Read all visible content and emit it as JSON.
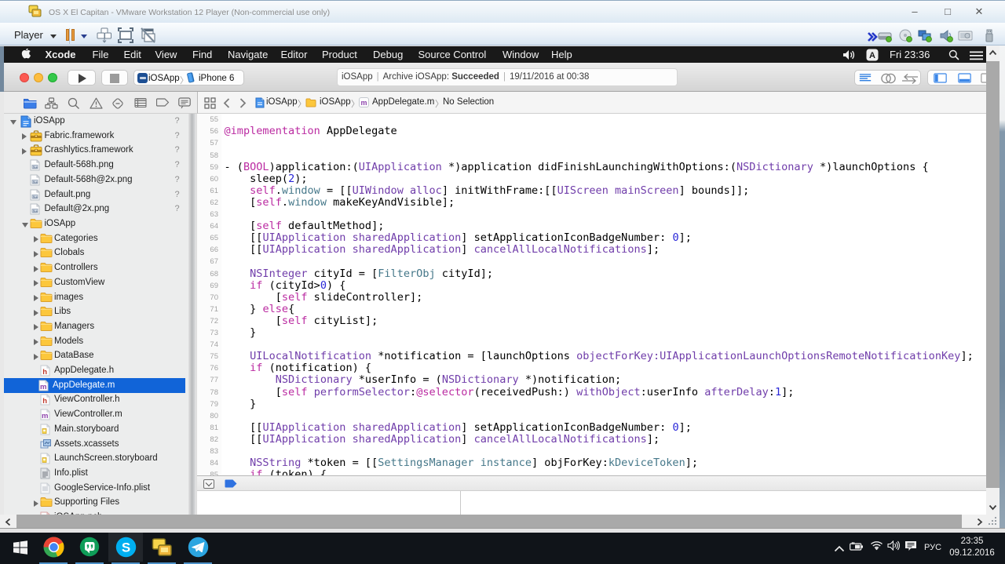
{
  "vmware": {
    "title": "OS X El Capitan - VMware Workstation 12 Player (Non-commercial use only)",
    "window_buttons": [
      "minimize",
      "maximize",
      "close"
    ],
    "toolbar": {
      "player_label": "Player",
      "tray_icons": [
        "chevrons",
        "harddisk",
        "cdrom",
        "network",
        "sound",
        "display",
        "usb"
      ]
    }
  },
  "macos": {
    "menubar": {
      "items": [
        "Xcode",
        "File",
        "Edit",
        "View",
        "Find",
        "Navigate",
        "Editor",
        "Product",
        "Debug",
        "Source Control",
        "Window",
        "Help"
      ],
      "clock": "Fri 23:36"
    }
  },
  "xcode": {
    "toolbar": {
      "scheme": {
        "project": "iOSApp",
        "device": "iPhone 6"
      },
      "status": {
        "project": "iOSApp",
        "action": "Archive iOSApp:",
        "result": "Succeeded",
        "date": "19/11/2016 at 00:38"
      }
    },
    "jumpbar": {
      "segments": [
        "iOSApp",
        "iOSApp",
        "AppDelegate.m",
        "No Selection"
      ]
    },
    "navigator": {
      "rows": [
        {
          "depth": 0,
          "disc": "down",
          "icon": "project",
          "label": "iOSApp",
          "badge": "?"
        },
        {
          "depth": 1,
          "disc": "right",
          "icon": "framework",
          "label": "Fabric.framework",
          "badge": "?"
        },
        {
          "depth": 1,
          "disc": "right",
          "icon": "framework",
          "label": "Crashlytics.framework",
          "badge": "?"
        },
        {
          "depth": 1,
          "disc": "",
          "icon": "imagefile",
          "label": "Default-568h.png",
          "badge": "?"
        },
        {
          "depth": 1,
          "disc": "",
          "icon": "imagefile",
          "label": "Default-568h@2x.png",
          "badge": "?"
        },
        {
          "depth": 1,
          "disc": "",
          "icon": "imagefile",
          "label": "Default.png",
          "badge": "?"
        },
        {
          "depth": 1,
          "disc": "",
          "icon": "imagefile",
          "label": "Default@2x.png",
          "badge": "?"
        },
        {
          "depth": 1,
          "disc": "down",
          "icon": "folder",
          "label": "iOSApp",
          "badge": ""
        },
        {
          "depth": 2,
          "disc": "right",
          "icon": "folder",
          "label": "Categories",
          "badge": ""
        },
        {
          "depth": 2,
          "disc": "right",
          "icon": "folder",
          "label": "Clobals",
          "badge": ""
        },
        {
          "depth": 2,
          "disc": "right",
          "icon": "folder",
          "label": "Controllers",
          "badge": ""
        },
        {
          "depth": 2,
          "disc": "right",
          "icon": "folder",
          "label": "CustomView",
          "badge": ""
        },
        {
          "depth": 2,
          "disc": "right",
          "icon": "folder",
          "label": "images",
          "badge": ""
        },
        {
          "depth": 2,
          "disc": "right",
          "icon": "folder",
          "label": "Libs",
          "badge": ""
        },
        {
          "depth": 2,
          "disc": "right",
          "icon": "folder",
          "label": "Managers",
          "badge": ""
        },
        {
          "depth": 2,
          "disc": "right",
          "icon": "folder",
          "label": "Models",
          "badge": ""
        },
        {
          "depth": 2,
          "disc": "right",
          "icon": "folder",
          "label": "DataBase",
          "badge": ""
        },
        {
          "depth": 2,
          "disc": "",
          "icon": "hfile",
          "label": "AppDelegate.h",
          "badge": ""
        },
        {
          "depth": 2,
          "disc": "",
          "icon": "mfile",
          "label": "AppDelegate.m",
          "badge": "",
          "selected": true
        },
        {
          "depth": 2,
          "disc": "",
          "icon": "hfile",
          "label": "ViewController.h",
          "badge": ""
        },
        {
          "depth": 2,
          "disc": "",
          "icon": "mfile",
          "label": "ViewController.m",
          "badge": ""
        },
        {
          "depth": 2,
          "disc": "",
          "icon": "storyboard",
          "label": "Main.storyboard",
          "badge": ""
        },
        {
          "depth": 2,
          "disc": "",
          "icon": "xcassets",
          "label": "Assets.xcassets",
          "badge": ""
        },
        {
          "depth": 2,
          "disc": "",
          "icon": "storyboard",
          "label": "LaunchScreen.storyboard",
          "badge": ""
        },
        {
          "depth": 2,
          "disc": "",
          "icon": "plist",
          "label": "Info.plist",
          "badge": ""
        },
        {
          "depth": 2,
          "disc": "",
          "icon": "plistlight",
          "label": "GoogleService-Info.plist",
          "badge": ""
        },
        {
          "depth": 2,
          "disc": "right",
          "icon": "folder",
          "label": "Supporting Files",
          "badge": ""
        },
        {
          "depth": 2,
          "disc": "",
          "icon": "pchfile",
          "label": "iOSApp.pch",
          "badge": ""
        }
      ]
    },
    "editor": {
      "lines": [
        {
          "n": 55,
          "t": []
        },
        {
          "n": 56,
          "t": [
            [
              "p",
              "@implementation"
            ],
            [
              "k",
              " AppDelegate"
            ]
          ]
        },
        {
          "n": 57,
          "t": []
        },
        {
          "n": 58,
          "t": []
        },
        {
          "n": 59,
          "t": [
            [
              "k",
              "- ("
            ],
            [
              "p",
              "BOOL"
            ],
            [
              "k",
              ")application:("
            ],
            [
              "v",
              "UIApplication"
            ],
            [
              "k",
              " *)application didFinishLaunchingWithOptions:("
            ],
            [
              "v",
              "NSDictionary"
            ],
            [
              "k",
              " *)launchOptions {"
            ]
          ]
        },
        {
          "n": 60,
          "t": [
            [
              "k",
              "    sleep("
            ],
            [
              "b",
              "2"
            ],
            [
              "k",
              ");"
            ]
          ]
        },
        {
          "n": 61,
          "t": [
            [
              "k",
              "    "
            ],
            [
              "p",
              "self"
            ],
            [
              "k",
              "."
            ],
            [
              "t",
              "window"
            ],
            [
              "k",
              " = [["
            ],
            [
              "v",
              "UIWindow"
            ],
            [
              "k",
              " "
            ],
            [
              "v",
              "alloc"
            ],
            [
              "k",
              "] initWithFrame:[["
            ],
            [
              "v",
              "UIScreen"
            ],
            [
              "k",
              " "
            ],
            [
              "v",
              "mainScreen"
            ],
            [
              "k",
              "] bounds]];"
            ]
          ]
        },
        {
          "n": 62,
          "t": [
            [
              "k",
              "    ["
            ],
            [
              "p",
              "self"
            ],
            [
              "k",
              "."
            ],
            [
              "t",
              "window"
            ],
            [
              "k",
              " makeKeyAndVisible];"
            ]
          ]
        },
        {
          "n": 63,
          "t": []
        },
        {
          "n": 64,
          "t": [
            [
              "k",
              "    ["
            ],
            [
              "p",
              "self"
            ],
            [
              "k",
              " defaultMethod];"
            ]
          ]
        },
        {
          "n": 65,
          "t": [
            [
              "k",
              "    [["
            ],
            [
              "v",
              "UIApplication"
            ],
            [
              "k",
              " "
            ],
            [
              "v",
              "sharedApplication"
            ],
            [
              "k",
              "] setApplicationIconBadgeNumber: "
            ],
            [
              "b",
              "0"
            ],
            [
              "k",
              "];"
            ]
          ]
        },
        {
          "n": 66,
          "t": [
            [
              "k",
              "    [["
            ],
            [
              "v",
              "UIApplication"
            ],
            [
              "k",
              " "
            ],
            [
              "v",
              "sharedApplication"
            ],
            [
              "k",
              "] "
            ],
            [
              "v",
              "cancelAllLocalNotifications"
            ],
            [
              "k",
              "];"
            ]
          ]
        },
        {
          "n": 67,
          "t": []
        },
        {
          "n": 68,
          "t": [
            [
              "k",
              "    "
            ],
            [
              "v",
              "NSInteger"
            ],
            [
              "k",
              " cityId = ["
            ],
            [
              "t",
              "FilterObj"
            ],
            [
              "k",
              " cityId];"
            ]
          ]
        },
        {
          "n": 69,
          "t": [
            [
              "k",
              "    "
            ],
            [
              "p",
              "if"
            ],
            [
              "k",
              " (cityId>"
            ],
            [
              "b",
              "0"
            ],
            [
              "k",
              ") {"
            ]
          ]
        },
        {
          "n": 70,
          "t": [
            [
              "k",
              "        ["
            ],
            [
              "p",
              "self"
            ],
            [
              "k",
              " slideController];"
            ]
          ]
        },
        {
          "n": 71,
          "t": [
            [
              "k",
              "    } "
            ],
            [
              "p",
              "else"
            ],
            [
              "k",
              "{"
            ]
          ]
        },
        {
          "n": 72,
          "t": [
            [
              "k",
              "        ["
            ],
            [
              "p",
              "self"
            ],
            [
              "k",
              " cityList];"
            ]
          ]
        },
        {
          "n": 73,
          "t": [
            [
              "k",
              "    }"
            ]
          ]
        },
        {
          "n": 74,
          "t": []
        },
        {
          "n": 75,
          "t": [
            [
              "k",
              "    "
            ],
            [
              "v",
              "UILocalNotification"
            ],
            [
              "k",
              " *notification = [launchOptions "
            ],
            [
              "v",
              "objectForKey:UIApplicationLaunchOptionsRemoteNotificationKey"
            ],
            [
              "k",
              "];"
            ]
          ]
        },
        {
          "n": 76,
          "t": [
            [
              "k",
              "    "
            ],
            [
              "p",
              "if"
            ],
            [
              "k",
              " (notification) {"
            ]
          ]
        },
        {
          "n": 77,
          "t": [
            [
              "k",
              "        "
            ],
            [
              "v",
              "NSDictionary"
            ],
            [
              "k",
              " *userInfo = ("
            ],
            [
              "v",
              "NSDictionary"
            ],
            [
              "k",
              " *)notification;"
            ]
          ]
        },
        {
          "n": 78,
          "t": [
            [
              "k",
              "        ["
            ],
            [
              "p",
              "self"
            ],
            [
              "k",
              " "
            ],
            [
              "v",
              "performSelector"
            ],
            [
              "k",
              ":"
            ],
            [
              "p",
              "@selector"
            ],
            [
              "k",
              "(receivedPush:) "
            ],
            [
              "v",
              "withObject"
            ],
            [
              "k",
              ":userInfo "
            ],
            [
              "v",
              "afterDelay"
            ],
            [
              "k",
              ":"
            ],
            [
              "b",
              "1"
            ],
            [
              "k",
              "];"
            ]
          ]
        },
        {
          "n": 79,
          "t": [
            [
              "k",
              "    }"
            ]
          ]
        },
        {
          "n": 80,
          "t": []
        },
        {
          "n": 81,
          "t": [
            [
              "k",
              "    [["
            ],
            [
              "v",
              "UIApplication"
            ],
            [
              "k",
              " "
            ],
            [
              "v",
              "sharedApplication"
            ],
            [
              "k",
              "] setApplicationIconBadgeNumber: "
            ],
            [
              "b",
              "0"
            ],
            [
              "k",
              "];"
            ]
          ]
        },
        {
          "n": 82,
          "t": [
            [
              "k",
              "    [["
            ],
            [
              "v",
              "UIApplication"
            ],
            [
              "k",
              " "
            ],
            [
              "v",
              "sharedApplication"
            ],
            [
              "k",
              "] "
            ],
            [
              "v",
              "cancelAllLocalNotifications"
            ],
            [
              "k",
              "];"
            ]
          ]
        },
        {
          "n": 83,
          "t": []
        },
        {
          "n": 84,
          "t": [
            [
              "k",
              "    "
            ],
            [
              "v",
              "NSString"
            ],
            [
              "k",
              " *token = [["
            ],
            [
              "t",
              "SettingsManager"
            ],
            [
              "k",
              " "
            ],
            [
              "t",
              "instance"
            ],
            [
              "k",
              "] objForKey:"
            ],
            [
              "t",
              "kDeviceToken"
            ],
            [
              "k",
              "];"
            ]
          ]
        },
        {
          "n": 85,
          "t": [
            [
              "k",
              "    "
            ],
            [
              "p",
              "if"
            ],
            [
              "k",
              " (token) {"
            ]
          ]
        }
      ]
    }
  },
  "windows": {
    "taskbar": {
      "apps": [
        "chrome",
        "hangouts",
        "skype",
        "vmware",
        "telegram"
      ],
      "active_app": "skype",
      "tray": {
        "language": "РУС",
        "time": "23:35",
        "date": "09.12.2016"
      }
    }
  }
}
